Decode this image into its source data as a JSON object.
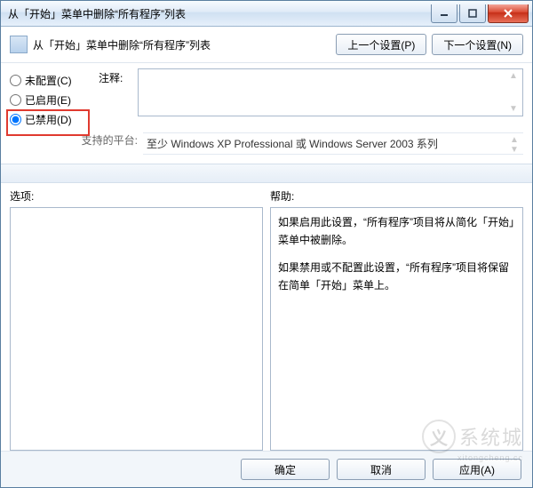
{
  "window": {
    "title": "从「开始」菜单中删除“所有程序”列表"
  },
  "header": {
    "title": "从「开始」菜单中删除“所有程序”列表",
    "prev_label": "上一个设置(P)",
    "next_label": "下一个设置(N)"
  },
  "radios": {
    "not_configured": "未配置(C)",
    "enabled": "已启用(E)",
    "disabled": "已禁用(D)",
    "selected": "disabled"
  },
  "comment": {
    "label": "注释:",
    "value": ""
  },
  "platform": {
    "label": "支持的平台:",
    "value": "至少 Windows XP Professional 或 Windows Server 2003 系列"
  },
  "lower": {
    "options_label": "选项:",
    "help_label": "帮助:",
    "help_paragraphs": [
      "如果启用此设置，“所有程序”项目将从简化「开始」菜单中被删除。",
      "如果禁用或不配置此设置，“所有程序”项目将保留在简单「开始」菜单上。"
    ]
  },
  "footer": {
    "ok": "确定",
    "cancel": "取消",
    "apply": "应用(A)"
  },
  "watermark": {
    "brand": "系统城",
    "sub": "xitongcheng.cc"
  }
}
